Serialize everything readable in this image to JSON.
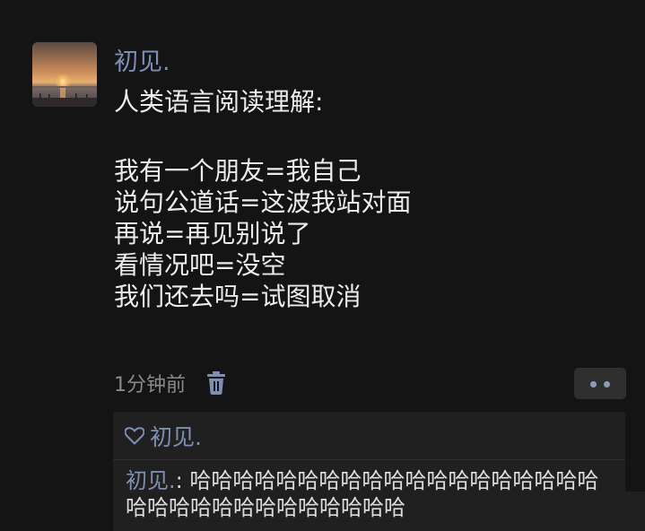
{
  "post": {
    "author": "初见.",
    "lines": [
      "人类语言阅读理解:",
      "",
      "我有一个朋友=我自己",
      "说句公道话=这波我站对面",
      "再说=再见别说了",
      "看情况吧=没空",
      "我们还去吗=试图取消"
    ],
    "time": "1分钟前"
  },
  "likes": {
    "names": "初见."
  },
  "comment": {
    "author": "初见.",
    "separator": ": ",
    "text": "哈哈哈哈哈哈哈哈哈哈哈哈哈哈哈哈哈哈哈哈哈哈哈哈哈哈哈哈哈哈哈哈"
  },
  "icons": {
    "delete": "trash-icon",
    "more": "more-dots-icon",
    "like": "heart-outline-icon"
  },
  "colors": {
    "background": "#141414",
    "name_link": "#7d8fb4",
    "text": "#ececec",
    "secondary": "#8a8a8a",
    "comment_bg": "#202020"
  }
}
